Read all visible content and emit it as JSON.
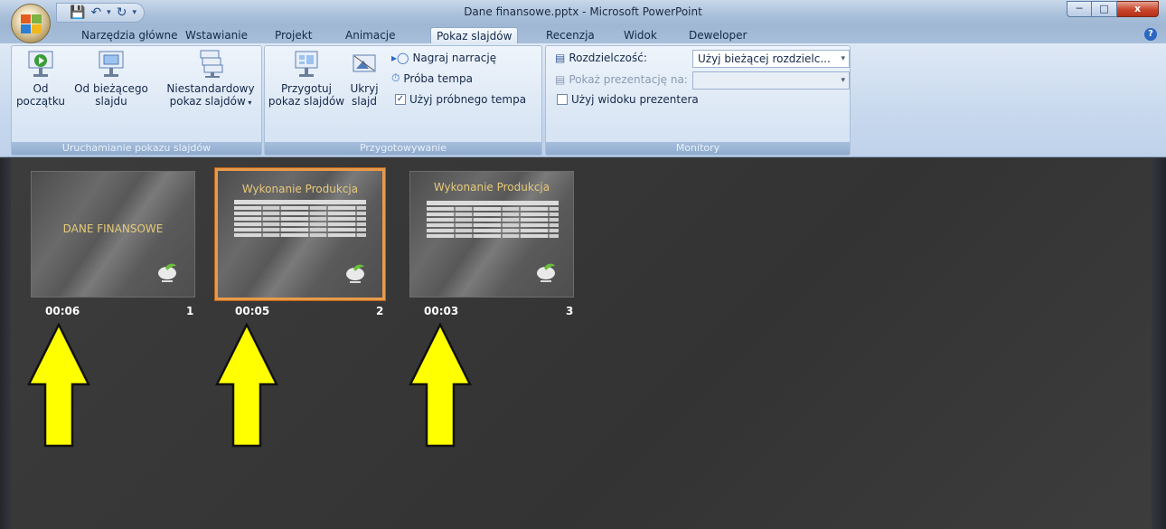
{
  "window": {
    "title": "Dane finansowe.pptx - Microsoft PowerPoint",
    "min_icon": "minimize-icon",
    "max_icon": "maximize-icon",
    "close_label": "x"
  },
  "qat": {
    "save_icon": "save-icon",
    "undo_icon": "undo-icon",
    "redo_icon": "redo-icon"
  },
  "tabs": [
    {
      "label": "Narzędzia główne"
    },
    {
      "label": "Wstawianie"
    },
    {
      "label": "Projekt"
    },
    {
      "label": "Animacje"
    },
    {
      "label": "Pokaz slajdów",
      "active": true
    },
    {
      "label": "Recenzja"
    },
    {
      "label": "Widok"
    },
    {
      "label": "Deweloper"
    }
  ],
  "ribbon": {
    "start_group": {
      "label": "Uruchamianie pokazu slajdów",
      "from_beginning": [
        "Od",
        "początku"
      ],
      "from_current": [
        "Od bieżącego",
        "slajdu"
      ],
      "custom": [
        "Niestandardowy",
        "pokaz slajdów"
      ]
    },
    "setup_group": {
      "label": "Przygotowywanie",
      "setup_show": [
        "Przygotuj",
        "pokaz slajdów"
      ],
      "hide_slide": [
        "Ukryj",
        "slajd"
      ],
      "record_narration": "Nagraj narrację",
      "rehearse_timings": "Próba tempa",
      "use_rehearsed": "Użyj próbnego tempa",
      "use_rehearsed_checked": true
    },
    "monitors_group": {
      "label": "Monitory",
      "resolution_label": "Rozdzielczość:",
      "resolution_value": "Użyj bieżącej rozdzielc...",
      "show_on_label": "Pokaż prezentację na:",
      "show_on_value": "",
      "presenter_view": "Użyj widoku prezentera",
      "presenter_view_checked": false
    }
  },
  "slides": [
    {
      "number": "1",
      "timing": "00:06",
      "title": "DANE FINANSOWE",
      "selected": false
    },
    {
      "number": "2",
      "timing": "00:05",
      "title": "Wykonanie Produkcja",
      "selected": true
    },
    {
      "number": "3",
      "timing": "00:03",
      "title": "Wykonanie Produkcja",
      "selected": false
    }
  ],
  "colors": {
    "arrow_fill": "#ffff00",
    "selection": "#e89a4a"
  }
}
